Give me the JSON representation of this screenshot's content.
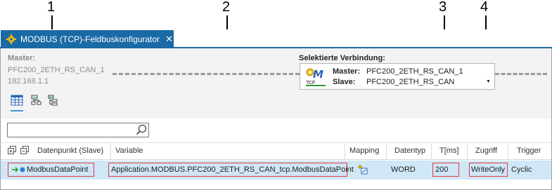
{
  "callouts": [
    "1",
    "2",
    "3",
    "4"
  ],
  "window": {
    "tab_title": "MODBUS (TCP)-Feldbuskonfigurator",
    "tab_close": "✕"
  },
  "master": {
    "label": "Master:",
    "name": "PFC200_2ETH_RS_CAN_1",
    "ip": "192.168.1.1"
  },
  "connection": {
    "label": "Selektierte Verbindung:",
    "master_label": "Master:",
    "master_value": "PFC200_2ETH_RS_CAN_1",
    "slave_label": "Slave:",
    "slave_value": "PFC200_2ETH_RS_CAN",
    "icon_text": "TCP"
  },
  "search": {
    "value": ""
  },
  "table": {
    "headers": {
      "datapoint": "Datenpunkt (Slave)",
      "variable": "Variable",
      "mapping": "Mapping",
      "datatype": "Datentyp",
      "t": "T[ms]",
      "access": "Zugriff",
      "trigger": "Trigger"
    },
    "row": {
      "datapoint": "ModbusDataPoint",
      "variable": "Application.MODBUS.PFC200_2ETH_RS_CAN_tcp.ModbusDataPoint",
      "datatype": "WORD",
      "t": "200",
      "access": "WriteOnly",
      "trigger": "Cyclic"
    }
  },
  "colors": {
    "tab_accent": "#1a6aa5",
    "row_selected": "#cfe7f7",
    "highlight_box": "#e03c3c"
  }
}
